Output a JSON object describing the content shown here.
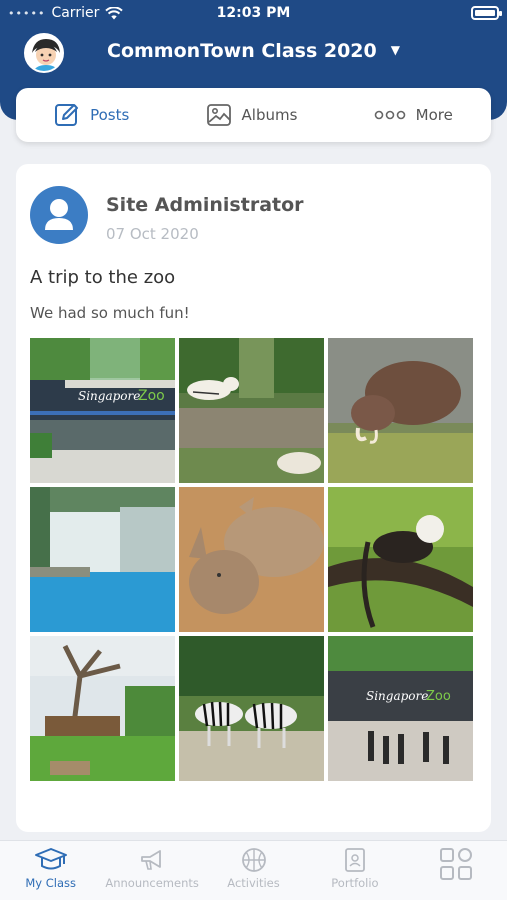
{
  "status": {
    "carrier": "Carrier",
    "time": "12:03 PM"
  },
  "header": {
    "class_name": "CommonTown Class 2020"
  },
  "tabs": [
    {
      "label": "Posts",
      "active": true,
      "icon": "edit-icon"
    },
    {
      "label": "Albums",
      "active": false,
      "icon": "image-icon"
    },
    {
      "label": "More",
      "active": false,
      "icon": "ellipsis-icon"
    }
  ],
  "post": {
    "author": "Site Administrator",
    "date": "07 Oct 2020",
    "title": "A trip to the zoo",
    "body": "We had so much fun!",
    "photos": [
      "zoo-entrance",
      "white-tigers",
      "warthog",
      "waterfall-pool",
      "rhinos",
      "monkey-on-branch",
      "tree-playground",
      "zebras",
      "zoo-entrance-crowd"
    ]
  },
  "bottom_nav": [
    {
      "label": "My Class",
      "active": true,
      "icon": "graduation-cap-icon"
    },
    {
      "label": "Announcements",
      "active": false,
      "icon": "megaphone-icon"
    },
    {
      "label": "Activities",
      "active": false,
      "icon": "basketball-icon"
    },
    {
      "label": "Portfolio",
      "active": false,
      "icon": "portfolio-icon"
    },
    {
      "label": "",
      "active": false,
      "icon": "apps-grid-icon"
    }
  ],
  "colors": {
    "header": "#1f4a86",
    "accent": "#2f6db5",
    "avatar_bg": "#3c7dc4"
  }
}
